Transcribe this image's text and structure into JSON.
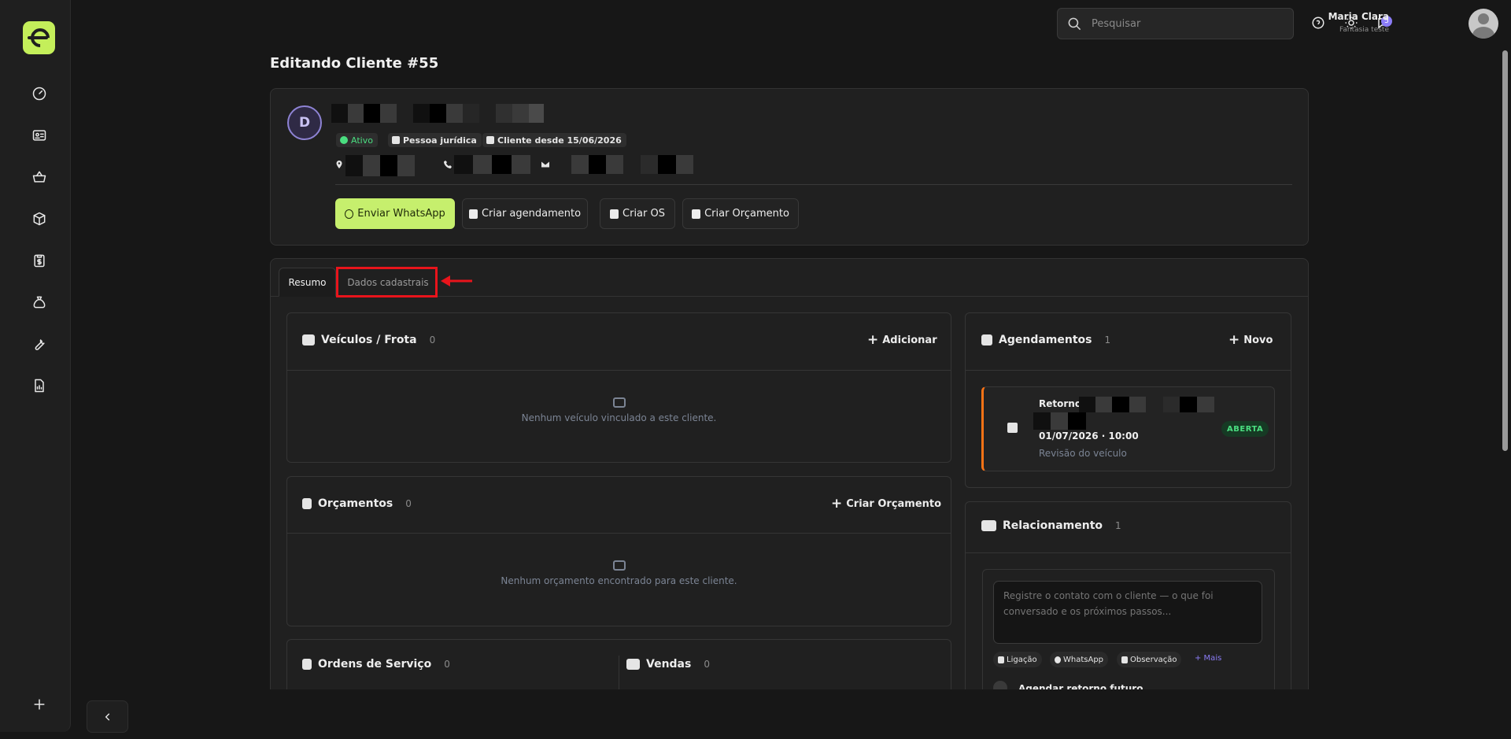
{
  "sidebar": {
    "logo_text": "e",
    "icons": [
      "dashboard-icon",
      "id-card-icon",
      "basket-icon",
      "box-icon",
      "clipboard-dollar-icon",
      "money-bag-icon",
      "wrench-icon",
      "report-icon"
    ],
    "add_icon": "plus-icon",
    "collapse_icon": "chevron-left-icon"
  },
  "topbar": {
    "search_placeholder": "Pesquisar",
    "notification_count": "5",
    "user_name": "Maria Clara",
    "user_role": "Fantasia teste"
  },
  "page": {
    "title": "Editando Cliente #55"
  },
  "client": {
    "avatar_initial": "D",
    "status": "Ativo",
    "type": "Pessoa jurídica",
    "since": "Cliente desde 15/06/2026",
    "actions": {
      "whatsapp": "Enviar WhatsApp",
      "schedule": "Criar agendamento",
      "os": "Criar OS",
      "quote": "Criar Orçamento"
    }
  },
  "tabs": [
    {
      "label": "Resumo",
      "active": true
    },
    {
      "label": "Dados cadastrais",
      "active": false
    }
  ],
  "vehicles": {
    "title": "Veículos / Frota",
    "count": "0",
    "action": "Adicionar",
    "empty": "Nenhum veículo vinculado a este cliente."
  },
  "quotes": {
    "title": "Orçamentos",
    "count": "0",
    "action": "Criar Orçamento",
    "empty": "Nenhum orçamento encontrado para este cliente."
  },
  "service_orders": {
    "title": "Ordens de Serviço",
    "count": "0"
  },
  "sales": {
    "title": "Vendas",
    "count": "0"
  },
  "appointments": {
    "title": "Agendamentos",
    "count": "1",
    "action": "Novo",
    "item": {
      "title": "Retorno:",
      "date": "01/07/2026 · 10:00",
      "desc": "Revisão do veículo",
      "status": "ABERTA"
    }
  },
  "relationship": {
    "title": "Relacionamento",
    "count": "1",
    "placeholder": "Registre o contato com o cliente — o que foi conversado e os próximos passos...",
    "chips": [
      "Ligação",
      "WhatsApp",
      "Observação"
    ],
    "more": "+ Mais",
    "followup": "Agendar retorno futuro"
  },
  "colors": {
    "accent": "#c6ef6d",
    "background": "#171717",
    "panel": "#202020",
    "status_active": "#4ade80",
    "appointment_border": "#f97316",
    "highlight": "#e8141b",
    "link": "#8b7cf6"
  }
}
